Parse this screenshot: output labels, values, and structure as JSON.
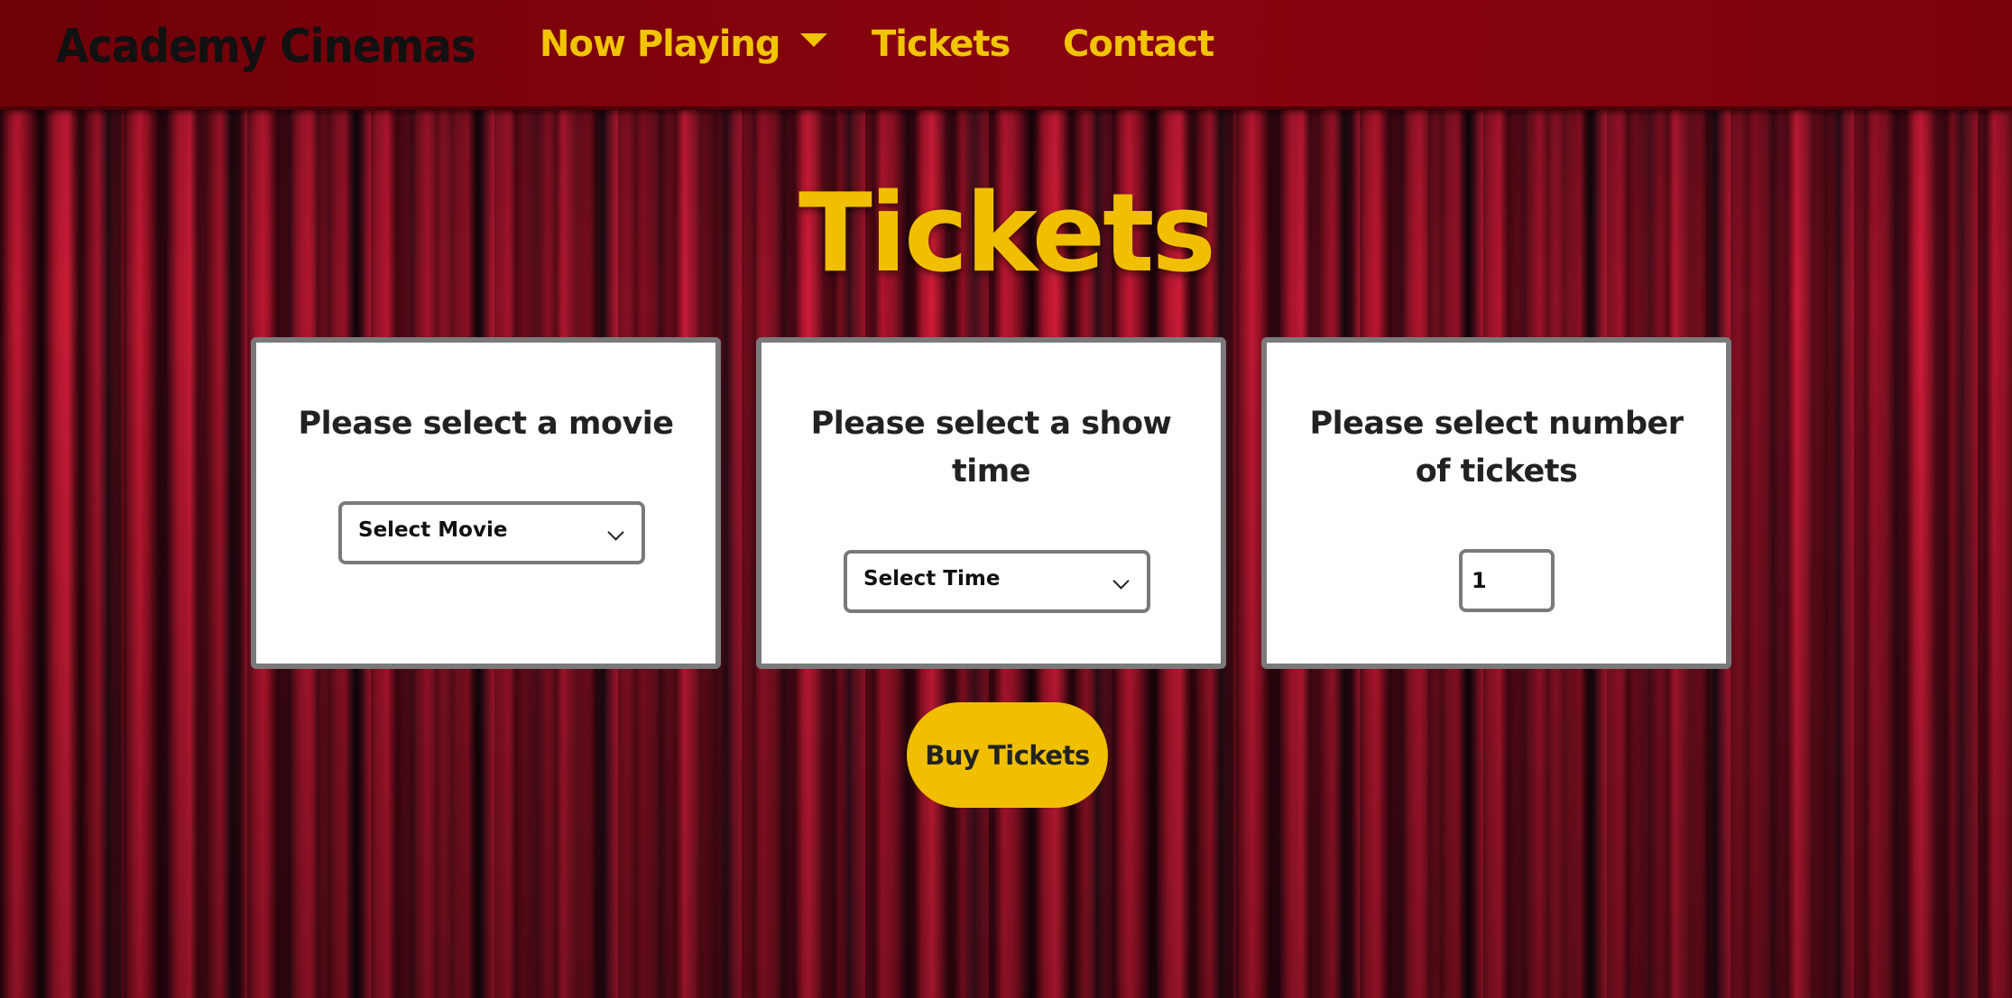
{
  "brand": "Academy Cinemas",
  "nav": {
    "now_playing": "Now Playing",
    "tickets": "Tickets",
    "contact": "Contact"
  },
  "page_title": "Tickets",
  "cards": {
    "movie": {
      "heading": "Please select a movie",
      "select_value": "Select Movie"
    },
    "showtime": {
      "heading": "Please select a show time",
      "select_value": "Select Time"
    },
    "quantity": {
      "heading": "Please select number of tickets",
      "value": "1"
    }
  },
  "buy_button": "Buy Tickets",
  "colors": {
    "accent_yellow": "#f1c400",
    "nav_red": "#8a0410",
    "card_border": "#7a7a7a"
  },
  "icons": {
    "dropdown_caret": "caret-down-icon",
    "select_chevron": "chevron-down-icon"
  }
}
